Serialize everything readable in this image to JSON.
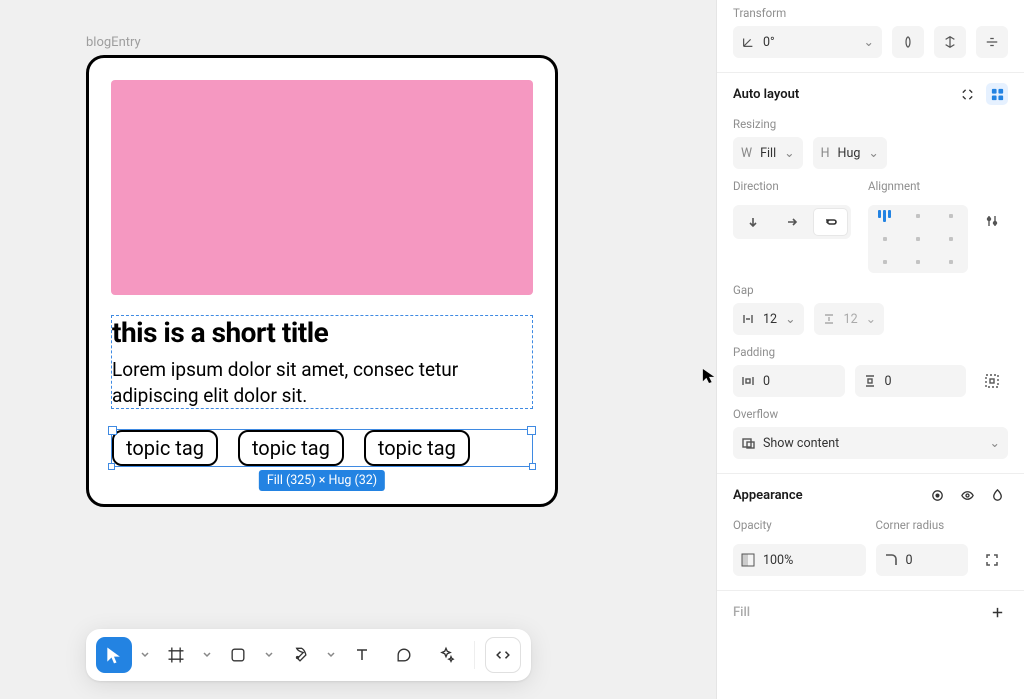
{
  "canvas": {
    "frame_label": "blogEntry",
    "title": "this is a short title",
    "body": "Lorem ipsum dolor sit amet, consec tetur adipiscing elit dolor sit.",
    "tags": [
      "topic tag",
      "topic tag",
      "topic tag"
    ],
    "selection_dims": "Fill (325) × Hug (32)"
  },
  "panel": {
    "transform": {
      "label": "Transform",
      "rotation": "0°"
    },
    "auto_layout": {
      "title": "Auto layout",
      "resizing_label": "Resizing",
      "width_mode": "Fill",
      "height_mode": "Hug",
      "direction_label": "Direction",
      "alignment_label": "Alignment",
      "gap_label": "Gap",
      "gap_value": "12",
      "gap_cross_value": "12",
      "padding_label": "Padding",
      "padding_h": "0",
      "padding_v": "0",
      "overflow_label": "Overflow",
      "overflow_value": "Show content"
    },
    "appearance": {
      "title": "Appearance",
      "opacity_label": "Opacity",
      "opacity_value": "100%",
      "corner_label": "Corner radius",
      "corner_value": "0"
    },
    "fill": {
      "title": "Fill"
    }
  },
  "toolbar": {
    "tools": [
      "move",
      "frame",
      "rectangle",
      "pen",
      "text",
      "comment",
      "ai",
      "code"
    ]
  }
}
